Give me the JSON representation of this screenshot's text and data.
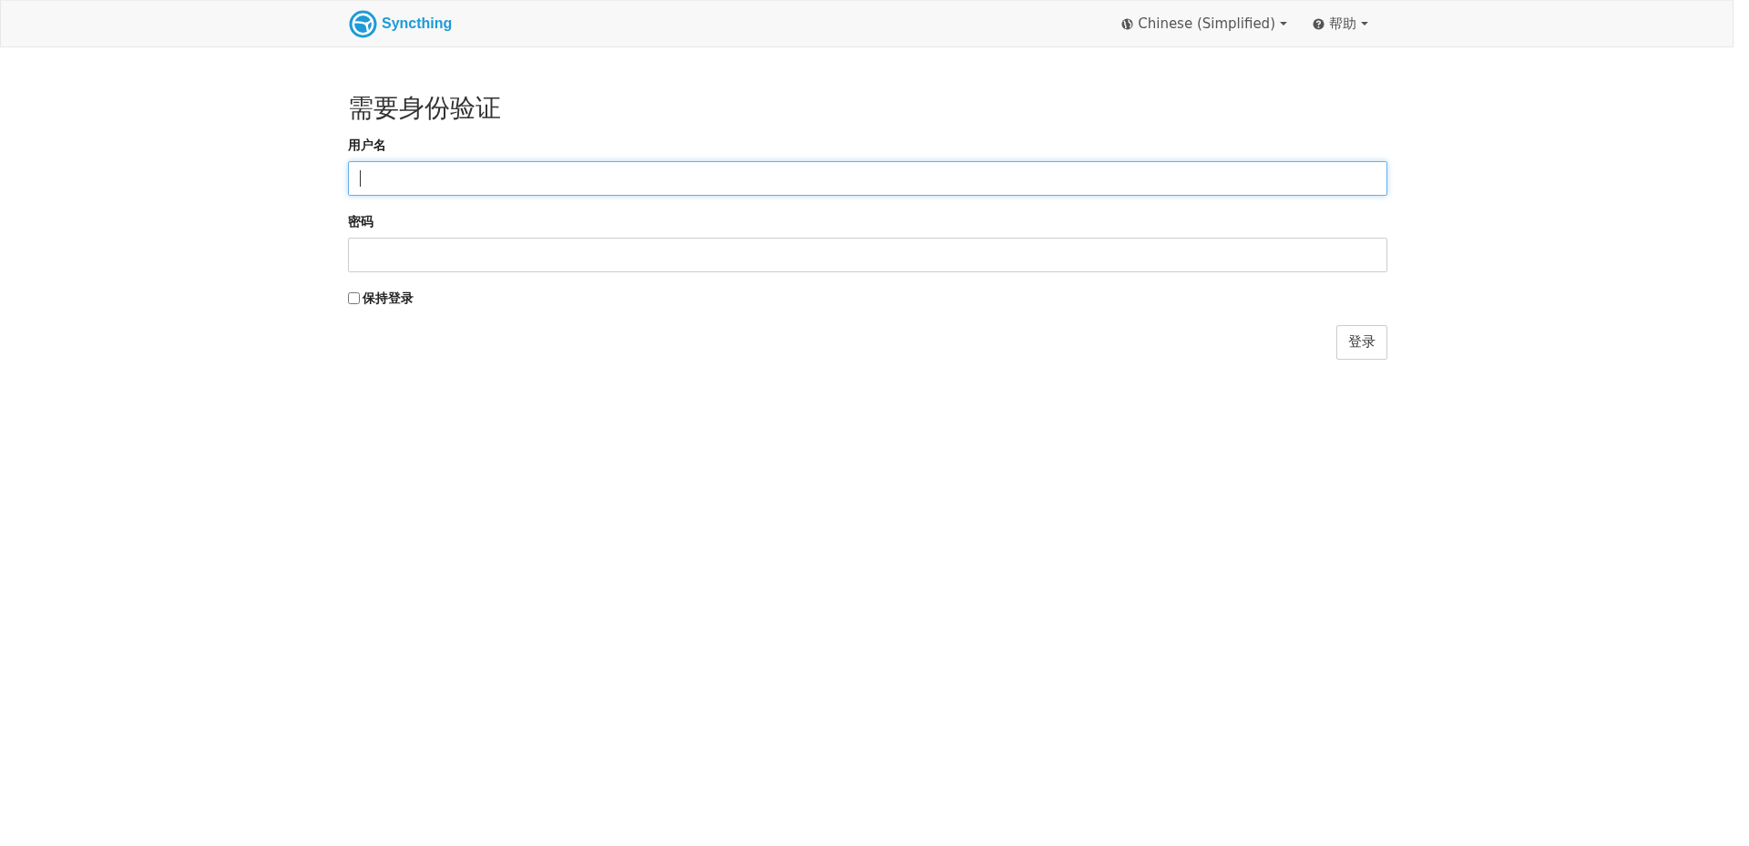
{
  "navbar": {
    "brand": "Syncthing",
    "menus": [
      {
        "kind": "language",
        "label": "Chinese (Simplified)"
      },
      {
        "kind": "help",
        "label": "帮助"
      }
    ]
  },
  "form": {
    "title": "需要身份验证",
    "fields": [
      {
        "label": "用户名",
        "focused": true
      },
      {
        "label": "密码",
        "focused": false
      }
    ],
    "remember": {
      "label": "保持登录",
      "checked": false
    },
    "submit": "登录"
  }
}
